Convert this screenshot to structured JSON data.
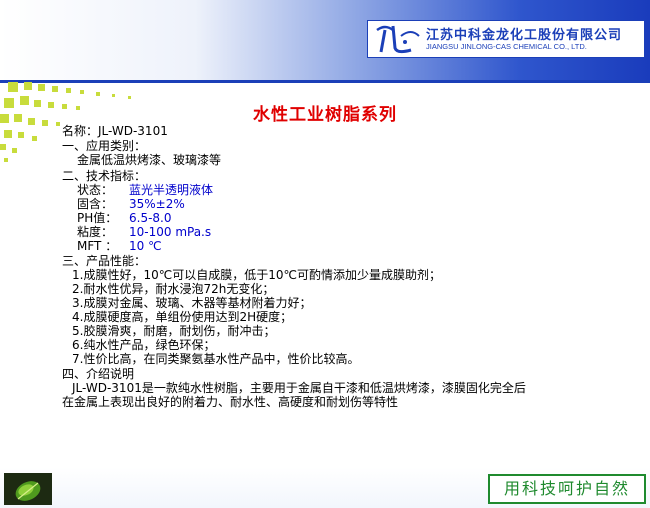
{
  "company": {
    "name_cn": "江苏中科金龙化工股份有限公司",
    "name_en": "JIANGSU JINLONG-CAS CHEMICAL CO., LTD."
  },
  "title": "水性工业树脂系列",
  "product": {
    "name_line": "名称：JL-WD-3101"
  },
  "sections": {
    "application": {
      "heading": "一、应用类别：",
      "lines": [
        "金属低温烘烤漆、玻璃漆等"
      ]
    },
    "specs": {
      "heading": "二、技术指标：",
      "rows": [
        {
          "label": "状态：",
          "value": "蓝光半透明液体"
        },
        {
          "label": "固含：",
          "value": "35%±2%"
        },
        {
          "label": "PH值：",
          "value": "6.5-8.0"
        },
        {
          "label": "粘度：",
          "value": "10-100 mPa.s"
        },
        {
          "label": "MFT ：",
          "value": "10 ℃"
        }
      ]
    },
    "performance": {
      "heading": "三、产品性能：",
      "lines": [
        "1.成膜性好，10℃可以自成膜，低于10℃可酌情添加少量成膜助剂；",
        "2.耐水性优异，耐水浸泡72h无变化；",
        "3.成膜对金属、玻璃、木器等基材附着力好；",
        "4.成膜硬度高，单组份使用达到2H硬度；",
        "5.胶膜滑爽，耐磨，耐划伤，耐冲击；",
        "6.纯水性产品，绿色环保；",
        "7.性价比高，在同类聚氨基水性产品中，性价比较高。"
      ]
    },
    "intro": {
      "heading": "四、介绍说明",
      "lines": [
        "JL-WD-3101是一款纯水性树脂，主要用于金属自干漆和低温烘烤漆，漆膜固化完全后",
        "在金属上表现出良好的附着力、耐水性、高硬度和耐划伤等特性"
      ]
    }
  },
  "footer": {
    "slogan": "用科技呵护自然"
  },
  "colors": {
    "title": "#e00000",
    "spec_value": "#0000cc",
    "brand_blue": "#1b3fb8",
    "slogan_green": "#1f8a2e",
    "dots": "#c8dc3c"
  }
}
